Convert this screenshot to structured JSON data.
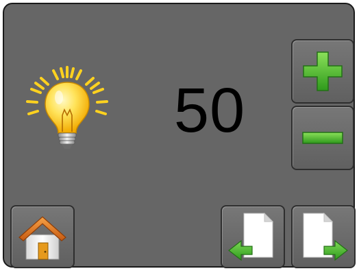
{
  "display": {
    "value": "50"
  },
  "icons": {
    "brightness": "lightbulb-icon",
    "increase": "plus-icon",
    "decrease": "minus-icon",
    "home": "home-icon",
    "previous_page": "page-back-arrow-icon",
    "next_page": "page-forward-arrow-icon"
  },
  "colors": {
    "panel_background": "#666666",
    "value_text": "#000000",
    "plus_minus_green": "#4bb832",
    "arrow_green": "#3fae2a",
    "bulb_yellow": "#ffd21f"
  }
}
